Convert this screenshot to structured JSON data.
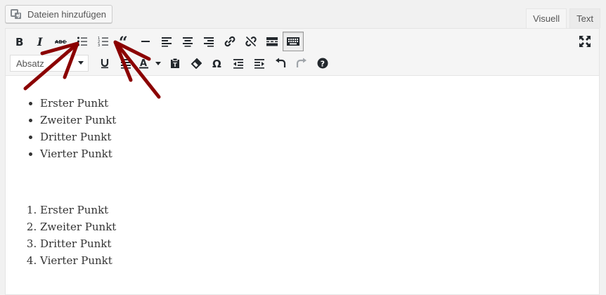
{
  "media": {
    "label": "Dateien hinzufügen",
    "icon": "media-icon"
  },
  "tabs": {
    "visual": "Visuell",
    "text": "Text"
  },
  "toolbar": {
    "row1": [
      {
        "name": "bold-button",
        "icon": "bold-icon"
      },
      {
        "name": "italic-button",
        "icon": "italic-icon"
      },
      {
        "name": "strikethrough-button",
        "icon": "strikethrough-icon"
      },
      {
        "name": "bullet-list-button",
        "icon": "bullet-list-icon"
      },
      {
        "name": "numbered-list-button",
        "icon": "numbered-list-icon"
      },
      {
        "name": "blockquote-button",
        "icon": "quote-icon"
      },
      {
        "name": "horizontal-line-button",
        "icon": "hr-icon"
      },
      {
        "name": "align-left-button",
        "icon": "align-left-icon"
      },
      {
        "name": "align-center-button",
        "icon": "align-center-icon"
      },
      {
        "name": "align-right-button",
        "icon": "align-right-icon"
      },
      {
        "name": "insert-link-button",
        "icon": "link-icon"
      },
      {
        "name": "remove-link-button",
        "icon": "unlink-icon"
      },
      {
        "name": "read-more-button",
        "icon": "more-tag-icon"
      },
      {
        "name": "toolbar-toggle-button",
        "icon": "keyboard-icon",
        "active": true
      }
    ],
    "format_select": "Absatz",
    "row2": [
      {
        "name": "underline-button",
        "icon": "underline-icon"
      },
      {
        "name": "justify-button",
        "icon": "justify-icon"
      },
      {
        "name": "text-color-button",
        "icon": "text-color-icon"
      },
      {
        "name": "paste-text-button",
        "icon": "paste-icon"
      },
      {
        "name": "clear-formatting-button",
        "icon": "eraser-icon"
      },
      {
        "name": "special-character-button",
        "icon": "omega-icon"
      },
      {
        "name": "outdent-button",
        "icon": "outdent-icon"
      },
      {
        "name": "indent-button",
        "icon": "indent-icon"
      },
      {
        "name": "undo-button",
        "icon": "undo-icon"
      },
      {
        "name": "redo-button",
        "icon": "redo-icon"
      },
      {
        "name": "help-button",
        "icon": "help-icon"
      }
    ],
    "fullscreen_icon": "fullscreen-icon"
  },
  "content": {
    "bullet_list": [
      "Erster Punkt",
      "Zweiter Punkt",
      "Dritter Punkt",
      "Vierter Punkt"
    ],
    "numbered_list": [
      "Erster Punkt",
      "Zweiter Punkt",
      "Dritter Punkt",
      "Vierter Punkt"
    ]
  },
  "colors": {
    "arrow": "#8b0000",
    "icon": "#23282d",
    "disabled_icon": "#a0a5aa"
  }
}
